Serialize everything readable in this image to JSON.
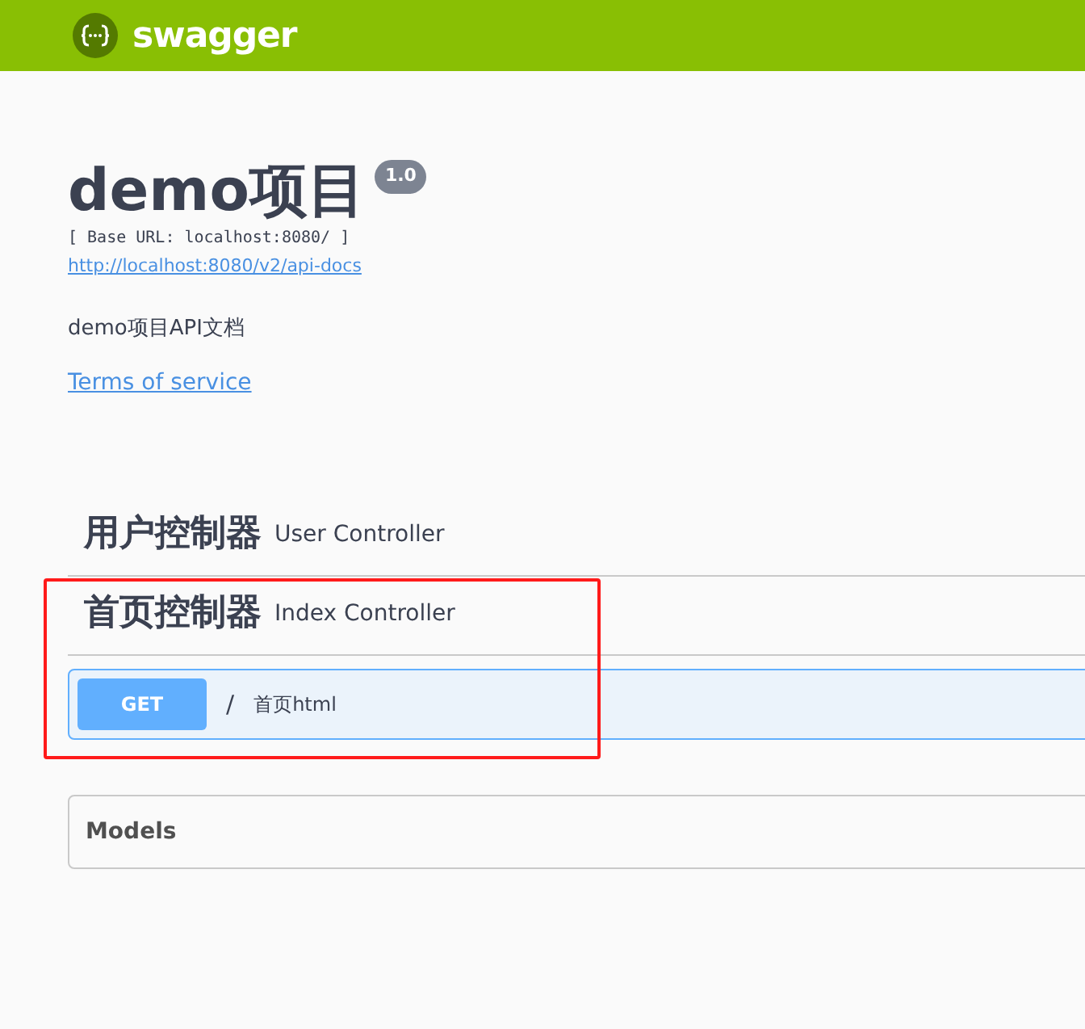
{
  "topbar": {
    "brand": "swagger"
  },
  "info": {
    "title": "demo项目",
    "version": "1.0",
    "base_url": "[ Base URL: localhost:8080/ ]",
    "docs_link": "http://localhost:8080/v2/api-docs",
    "description": "demo项目API文档",
    "terms_link": "Terms of service"
  },
  "tags": [
    {
      "name": "用户控制器",
      "description": "User Controller"
    },
    {
      "name": "首页控制器",
      "description": "Index Controller",
      "highlighted": true,
      "operations": [
        {
          "method": "GET",
          "separator": "/",
          "summary": "首页html"
        }
      ]
    }
  ],
  "models": {
    "title": "Models"
  }
}
